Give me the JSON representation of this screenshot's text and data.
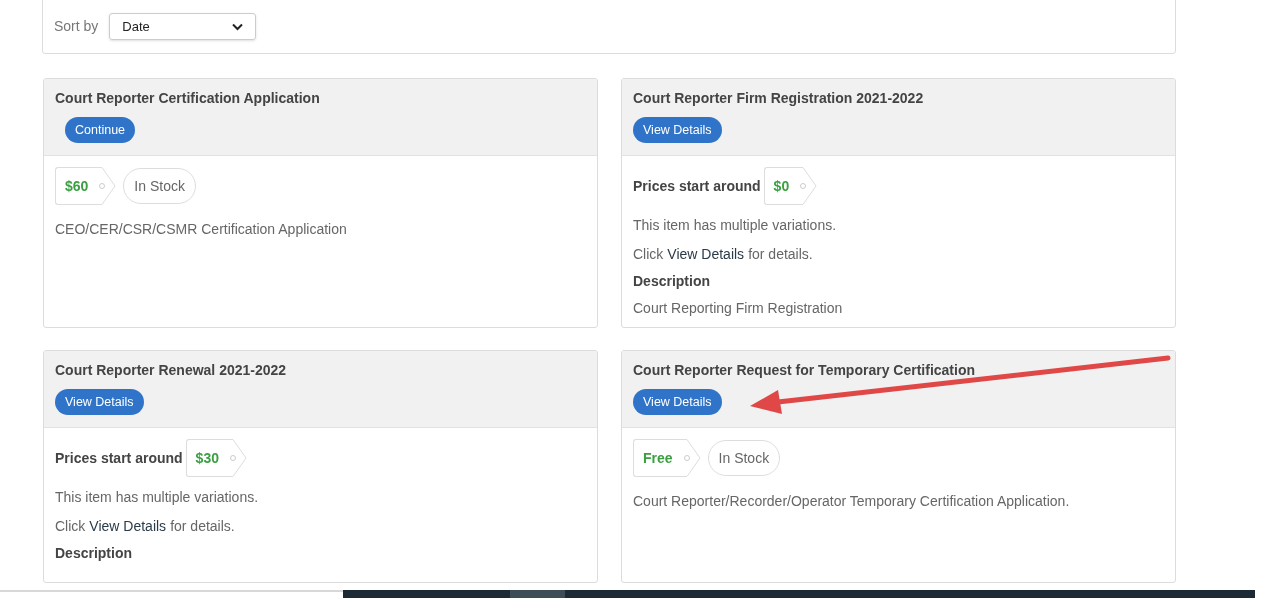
{
  "sort": {
    "label": "Sort by",
    "value": "Date"
  },
  "cards": [
    {
      "title": "Court Reporter Certification Application",
      "button": "Continue",
      "kind": "simple",
      "price": "$60",
      "stock": "In Stock",
      "description": "CEO/CER/CSR/CSMR Certification Application"
    },
    {
      "title": "Court Reporter Firm Registration 2021-2022",
      "button": "View Details",
      "kind": "variations",
      "prices_label": "Prices start around",
      "price": "$0",
      "note": "This item has multiple variations.",
      "click": {
        "before": "Click",
        "link": "View Details",
        "after": "for details."
      },
      "description_heading": "Description",
      "description": "Court Reporting Firm Registration"
    },
    {
      "title": "Court Reporter Renewal 2021-2022",
      "button": "View Details",
      "kind": "variations",
      "prices_label": "Prices start around",
      "price": "$30",
      "note": "This item has multiple variations.",
      "click": {
        "before": "Click",
        "link": "View Details",
        "after": "for details."
      },
      "description_heading": "Description"
    },
    {
      "title": "Court Reporter Request for Temporary Certification",
      "button": "View Details",
      "kind": "simple",
      "price": "Free",
      "stock": "In Stock",
      "description": "Court Reporter/Recorder/Operator Temporary Certification Application."
    }
  ]
}
